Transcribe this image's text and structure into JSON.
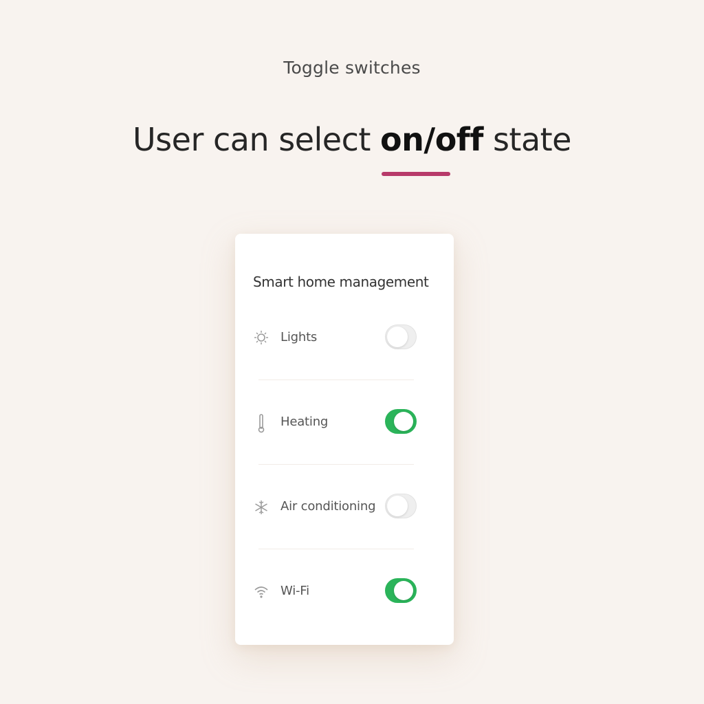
{
  "header": {
    "eyebrow": "Toggle switches",
    "headline_before": "User can select ",
    "headline_emphasis": "on/off",
    "headline_after": " state",
    "accent_color": "#b73a6a"
  },
  "card": {
    "title": "Smart home management",
    "items": [
      {
        "label": "Lights",
        "icon": "lightbulb-icon",
        "on": false
      },
      {
        "label": "Heating",
        "icon": "thermometer-icon",
        "on": true
      },
      {
        "label": "Air conditioning",
        "icon": "snowflake-icon",
        "on": false
      },
      {
        "label": "Wi-Fi",
        "icon": "wifi-icon",
        "on": true
      }
    ],
    "toggle_on_color": "#2bb45a",
    "toggle_off_color": "#efefef"
  }
}
